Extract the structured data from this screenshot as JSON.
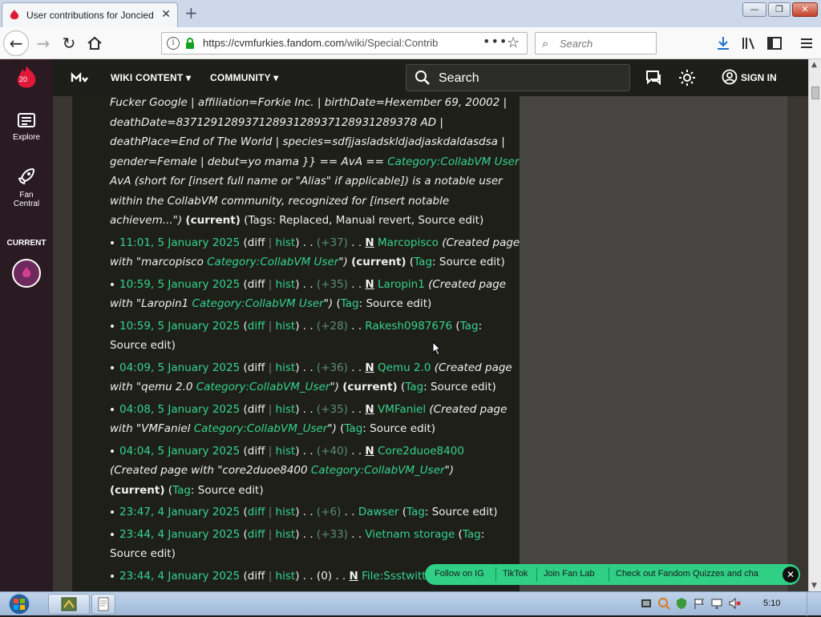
{
  "browser": {
    "tab_title": "User contributions for Joncied",
    "tab_close": "✕",
    "new_tab": "+",
    "url_host": "https://cvmfurkies.fandom.com",
    "url_path": "/wiki/Special:Contrib",
    "search_placeholder": "Search",
    "win_buttons": {
      "minimize": "—",
      "maximize": "❐",
      "close": "✕"
    }
  },
  "rail": {
    "badge": "20",
    "items": [
      {
        "label": "Explore"
      },
      {
        "label_1": "Fan",
        "label_2": "Central"
      }
    ],
    "current_label": "CURRENT"
  },
  "wiki_header": {
    "menu_1": "WIKI CONTENT",
    "menu_2": "COMMUNITY",
    "search_label": "Search",
    "sign_in": "SIGN IN"
  },
  "content": {
    "intro": {
      "l1": "Fucker Google | affiliation=Forkie Inc. | birthDate=Hexember 69, 20002 |",
      "l2": "deathDate=837129128937128931289371289312893​78 AD |",
      "l3": "deathPlace=End of The World | species=sdfjjasladskldjadjaskdaldasdsa |",
      "l4a": "gender=Female | debut=yo mama }} == AvA == ",
      "l4b": "Category:CollabVM User",
      "l5": "AvA (short for [insert full name or \"Alias\" if applicable]) is a notable user",
      "l6": "within the CollabVM community, recognized for [insert notable",
      "l7a": "achievem...\")",
      "l7b": "(current)",
      "l7c": "(Tags: Replaced, Manual revert, Source edit)"
    },
    "entries": [
      {
        "time": "11:01, 5 January 2025",
        "diff": "diff",
        "hist": "hist",
        "size": "(+37)",
        "new": "N",
        "page": "Marcopisco",
        "sum_a": "(Created page",
        "sum_b": "with \"marcopisco ",
        "sum_cat": "Category:CollabVM User",
        "sum_end": "\")",
        "current": "(current)",
        "tag_word": "Tag",
        "tag_val": ": Source edit)"
      },
      {
        "time": "10:59, 5 January 2025",
        "diff": "diff",
        "hist": "hist",
        "size": "(+35)",
        "new": "N",
        "page": "Laropin1",
        "sum_a": "(Created page",
        "sum_b": "with \"Laropin1 ",
        "sum_cat": "Category:CollabVM User",
        "sum_end": "\")",
        "tag_word": "Tag",
        "tag_val": ": Source edit)"
      },
      {
        "time": "10:59, 5 January 2025",
        "diff": "diff",
        "hist": "hist",
        "size": "(+28)",
        "page": "Rakesh0987676",
        "tag_word": "Tag",
        "tag_val": ":",
        "tag_val2": "Source edit)"
      },
      {
        "time": "04:09, 5 January 2025",
        "diff": "diff",
        "hist": "hist",
        "size": "(+36)",
        "new": "N",
        "page": "Qemu 2.0",
        "sum_a": "(Created page",
        "sum_b": "with \"qemu 2.0 ",
        "sum_cat": "Category:CollabVM_User",
        "sum_end": "\")",
        "current": "(current)",
        "tag_word": "Tag",
        "tag_val": ": Source edit)"
      },
      {
        "time": "04:08, 5 January 2025",
        "diff": "diff",
        "hist": "hist",
        "size": "(+35)",
        "new": "N",
        "page": "VMFaniel",
        "sum_a": "(Created page",
        "sum_b": "with \"VMFaniel ",
        "sum_cat": "Category:CollabVM_User",
        "sum_end": "\")",
        "tag_word": "Tag",
        "tag_val": ": Source edit)"
      },
      {
        "time": "04:04, 5 January 2025",
        "diff": "diff",
        "hist": "hist",
        "size": "(+40)",
        "new": "N",
        "page": "Core2duoe8400",
        "sum_b": "(Created page with \"core2duoe8400 ",
        "sum_cat": "Category:CollabVM_User",
        "sum_end": "\")",
        "current": "(current)",
        "tag_word": "Tag",
        "tag_val": ": Source edit)"
      },
      {
        "time": "23:47, 4 January 2025",
        "diff": "diff",
        "hist": "hist",
        "size": "(+6)",
        "page": "Dawser",
        "tag_word": "Tag",
        "tag_val": ": Source edit)"
      },
      {
        "time": "23:44, 4 January 2025",
        "diff": "diff",
        "hist": "hist",
        "size": "(+33)",
        "page": "Vietnam storage",
        "tag_word": "Tag",
        "tag_val": ":",
        "tag_val2": "Source edit)"
      },
      {
        "time": "23:44, 4 January 2025",
        "diff": "diff",
        "hist": "hist",
        "size": "(0)",
        "new": "N",
        "page": "File:Ssstwitter.c"
      }
    ]
  },
  "pillbar": {
    "items": [
      "Follow on IG",
      "TikTok",
      "Join Fan Lab",
      "Check out Fandom Quizzes and cha"
    ],
    "close": "✕"
  },
  "taskbar": {
    "clock": "5:10"
  }
}
